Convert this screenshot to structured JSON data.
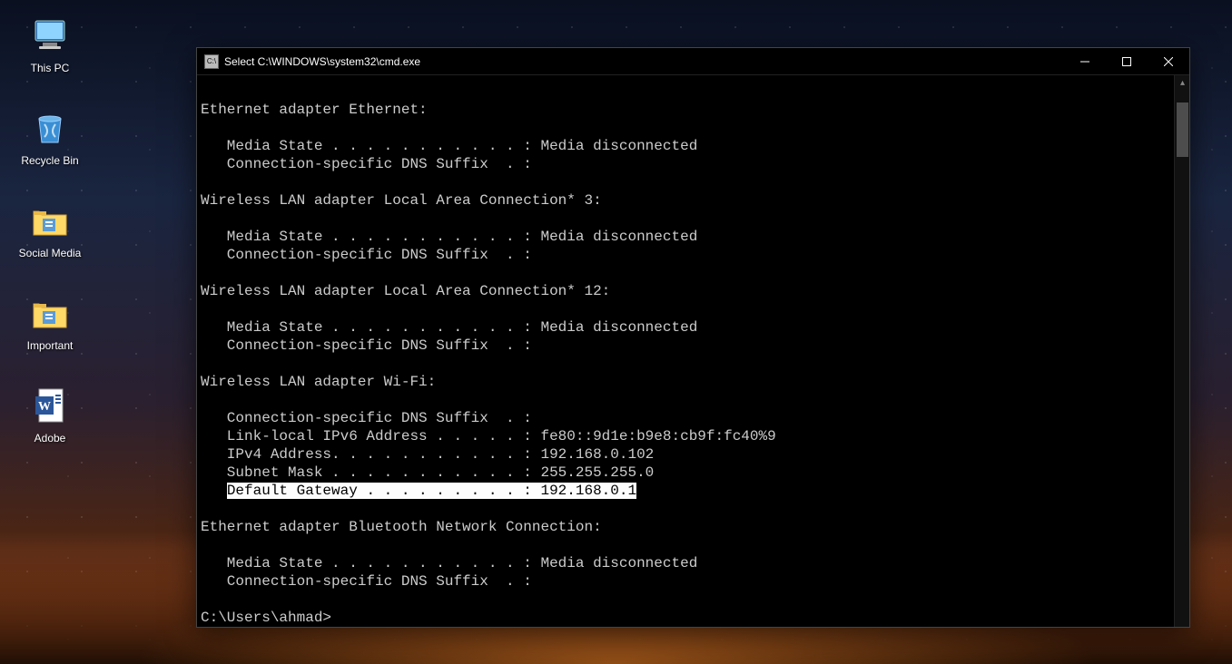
{
  "desktop": {
    "icons": [
      {
        "name": "this-pc",
        "label": "This PC"
      },
      {
        "name": "recycle-bin",
        "label": "Recycle Bin"
      },
      {
        "name": "social-media",
        "label": "Social Media"
      },
      {
        "name": "important",
        "label": "Important"
      },
      {
        "name": "adobe",
        "label": "Adobe"
      }
    ]
  },
  "window": {
    "title": "Select C:\\WINDOWS\\system32\\cmd.exe"
  },
  "terminal": {
    "lines": [
      "",
      "Ethernet adapter Ethernet:",
      "",
      "   Media State . . . . . . . . . . . : Media disconnected",
      "   Connection-specific DNS Suffix  . :",
      "",
      "Wireless LAN adapter Local Area Connection* 3:",
      "",
      "   Media State . . . . . . . . . . . : Media disconnected",
      "   Connection-specific DNS Suffix  . :",
      "",
      "Wireless LAN adapter Local Area Connection* 12:",
      "",
      "   Media State . . . . . . . . . . . : Media disconnected",
      "   Connection-specific DNS Suffix  . :",
      "",
      "Wireless LAN adapter Wi-Fi:",
      "",
      "   Connection-specific DNS Suffix  . :",
      "   Link-local IPv6 Address . . . . . : fe80::9d1e:b9e8:cb9f:fc40%9",
      "   IPv4 Address. . . . . . . . . . . : 192.168.0.102",
      "   Subnet Mask . . . . . . . . . . . : 255.255.255.0",
      "   Default Gateway . . . . . . . . . : 192.168.0.1",
      "",
      "Ethernet adapter Bluetooth Network Connection:",
      "",
      "   Media State . . . . . . . . . . . : Media disconnected",
      "   Connection-specific DNS Suffix  . :",
      "",
      "C:\\Users\\ahmad>"
    ],
    "highlighted_line_index": 22,
    "highlighted_substring": "Default Gateway . . . . . . . . . : 192.168.0.1"
  }
}
